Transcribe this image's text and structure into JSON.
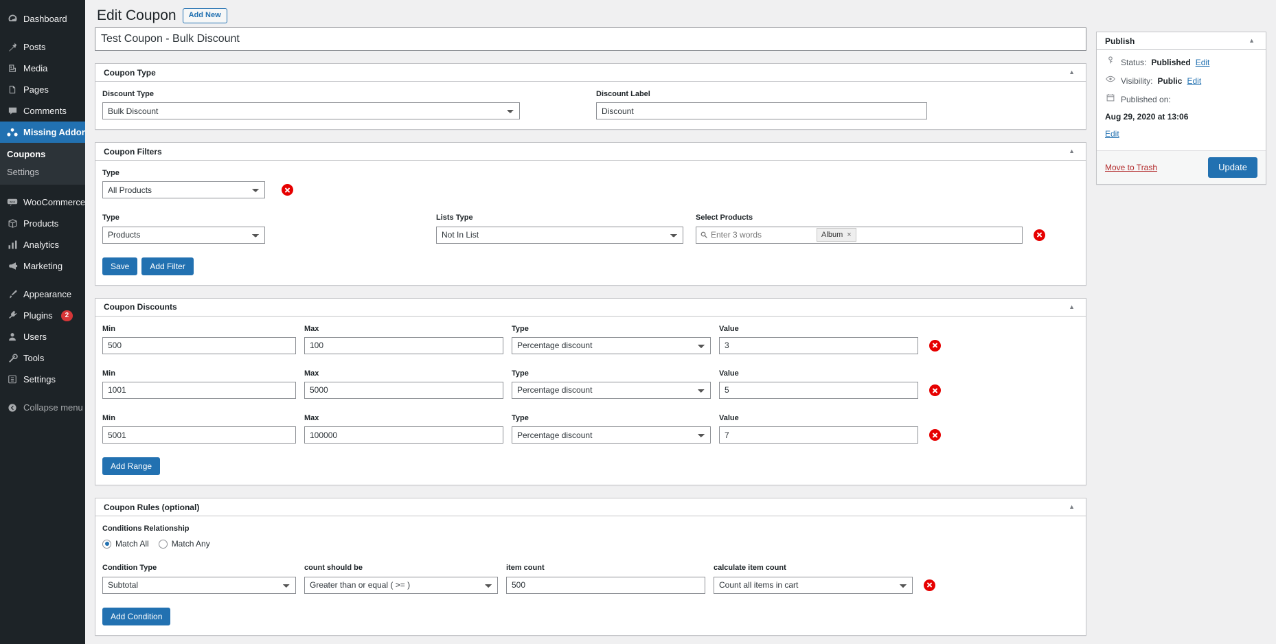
{
  "sidebar": {
    "items": [
      {
        "label": "Dashboard",
        "icon": "dashboard-icon",
        "current": false,
        "sep": false
      },
      {
        "label": "Posts",
        "icon": "pin-icon",
        "current": false,
        "sep": true
      },
      {
        "label": "Media",
        "icon": "media-icon",
        "current": false,
        "sep": false
      },
      {
        "label": "Pages",
        "icon": "page-icon",
        "current": false,
        "sep": false
      },
      {
        "label": "Comments",
        "icon": "comment-icon",
        "current": false,
        "sep": false
      },
      {
        "label": "Missing Addons",
        "icon": "addons-icon",
        "current": true,
        "sep": false
      },
      {
        "label": "WooCommerce",
        "icon": "woocommerce-icon",
        "current": false,
        "sep": true
      },
      {
        "label": "Products",
        "icon": "box-icon",
        "current": false,
        "sep": false
      },
      {
        "label": "Analytics",
        "icon": "chart-icon",
        "current": false,
        "sep": false
      },
      {
        "label": "Marketing",
        "icon": "megaphone-icon",
        "current": false,
        "sep": false
      },
      {
        "label": "Appearance",
        "icon": "brush-icon",
        "current": false,
        "sep": true
      },
      {
        "label": "Plugins",
        "icon": "plug-icon",
        "current": false,
        "sep": false,
        "badge": "2"
      },
      {
        "label": "Users",
        "icon": "user-icon",
        "current": false,
        "sep": false
      },
      {
        "label": "Tools",
        "icon": "wrench-icon",
        "current": false,
        "sep": false
      },
      {
        "label": "Settings",
        "icon": "settings-icon",
        "current": false,
        "sep": false
      },
      {
        "label": "Collapse menu",
        "icon": "collapse-icon",
        "current": false,
        "sep": true,
        "dim": true
      }
    ],
    "submenu": [
      {
        "label": "Coupons",
        "current": true
      },
      {
        "label": "Settings",
        "current": false
      }
    ]
  },
  "header": {
    "title": "Edit Coupon",
    "add_new_label": "Add New"
  },
  "post_title": {
    "value": "Test Coupon - Bulk Discount"
  },
  "coupon_type": {
    "panel_title": "Coupon Type",
    "discount_type_label": "Discount Type",
    "discount_type_value": "Bulk Discount",
    "discount_label_label": "Discount Label",
    "discount_label_value": "Discount"
  },
  "coupon_filters": {
    "panel_title": "Coupon Filters",
    "row1": {
      "type_label": "Type",
      "type_value": "All Products"
    },
    "row2": {
      "type_label": "Type",
      "type_value": "Products",
      "lists_type_label": "Lists Type",
      "lists_type_value": "Not In List",
      "select_products_label": "Select Products",
      "select_products_placeholder": "Enter 3 words",
      "tokens": [
        "Album"
      ]
    },
    "save_label": "Save",
    "add_filter_label": "Add Filter"
  },
  "coupon_discounts": {
    "panel_title": "Coupon Discounts",
    "labels": {
      "min": "Min",
      "max": "Max",
      "type": "Type",
      "value": "Value"
    },
    "rows": [
      {
        "min": "500",
        "max": "100",
        "type": "Percentage discount",
        "value": "3"
      },
      {
        "min": "1001",
        "max": "5000",
        "type": "Percentage discount",
        "value": "5"
      },
      {
        "min": "5001",
        "max": "100000",
        "type": "Percentage discount",
        "value": "7"
      }
    ],
    "add_range_label": "Add Range"
  },
  "coupon_rules": {
    "panel_title": "Coupon Rules (optional)",
    "relationship_label": "Conditions Relationship",
    "match_all_label": "Match All",
    "match_any_label": "Match Any",
    "selected_relationship": "Match All",
    "labels": {
      "condition_type": "Condition Type",
      "count_should_be": "count should be",
      "item_count": "item count",
      "calculate_item_count": "calculate item count"
    },
    "condition": {
      "condition_type": "Subtotal",
      "count_should_be": "Greater than or equal ( >= )",
      "item_count": "500",
      "calculate_item_count": "Count all items in cart"
    },
    "add_condition_label": "Add Condition"
  },
  "publish": {
    "panel_title": "Publish",
    "status_prefix": "Status:",
    "status_value": "Published",
    "status_edit": "Edit",
    "visibility_prefix": "Visibility:",
    "visibility_value": "Public",
    "visibility_edit": "Edit",
    "published_prefix": "Published on:",
    "published_value": "Aug 29, 2020 at 13:06",
    "published_edit": "Edit",
    "trash_label": "Move to Trash",
    "update_label": "Update"
  },
  "colors": {
    "accent": "#2271b1",
    "sidebar_bg": "#1d2327",
    "delete": "#e60000",
    "trash": "#b32d2e",
    "badge": "#d63638"
  }
}
